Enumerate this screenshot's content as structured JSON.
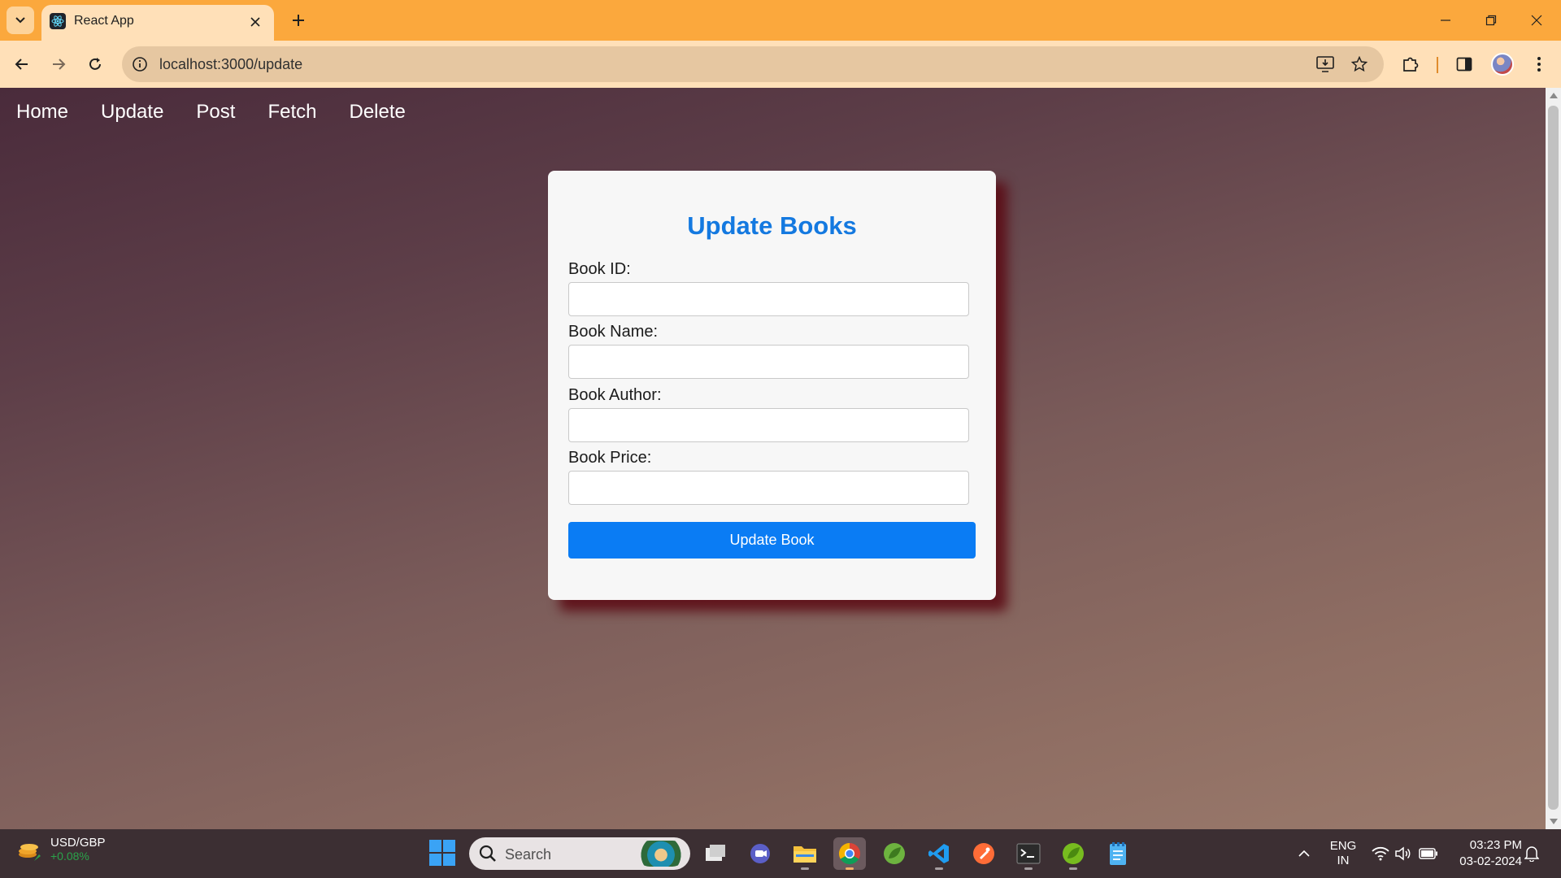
{
  "browser": {
    "tab_title": "React App",
    "url": "localhost:3000/update"
  },
  "app": {
    "nav": [
      "Home",
      "Update",
      "Post",
      "Fetch",
      "Delete"
    ],
    "form": {
      "title": "Update Books",
      "fields": [
        {
          "label": "Book ID:",
          "value": ""
        },
        {
          "label": "Book Name:",
          "value": ""
        },
        {
          "label": "Book Author:",
          "value": ""
        },
        {
          "label": "Book Price:",
          "value": ""
        }
      ],
      "submit_label": "Update Book"
    }
  },
  "taskbar": {
    "widget": {
      "title": "USD/GBP",
      "change": "+0.08%"
    },
    "search_placeholder": "Search",
    "lang": {
      "line1": "ENG",
      "line2": "IN"
    },
    "time": "03:23 PM",
    "date": "03-02-2024"
  },
  "colors": {
    "accent": "#1479e0",
    "button": "#0a7cf4",
    "tabbar": "#fba83d",
    "positive": "#2aa34a"
  },
  "icons": [
    "react-icon",
    "search-icon",
    "windows-start-icon",
    "chrome-icon",
    "vscode-icon",
    "terminal-icon",
    "folder-icon",
    "notepad-icon",
    "wifi-icon",
    "volume-icon",
    "battery-icon",
    "bell-icon"
  ]
}
